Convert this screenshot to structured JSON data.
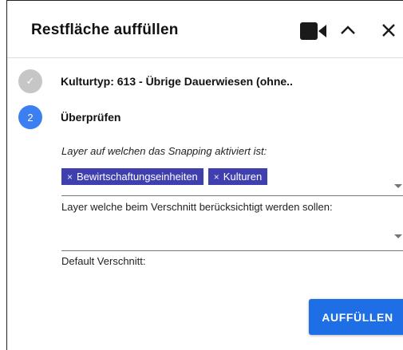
{
  "dialog": {
    "title": "Restfläche auffüllen",
    "header_icons": [
      "video-camera-icon",
      "chevron-up-icon",
      "close-icon"
    ]
  },
  "steps": [
    {
      "number": "✓",
      "label": "Kulturtyp: 613 - Übrige Dauerwiesen (ohne..",
      "state": "done"
    },
    {
      "number": "2",
      "label": "Überprüfen",
      "state": "active"
    }
  ],
  "fields": {
    "snapping_label": "Layer auf welchen das Snapping aktiviert ist:",
    "snapping_chips": [
      {
        "remove": "×",
        "label": "Bewirtschaftungseinheiten"
      },
      {
        "remove": "×",
        "label": "Kulturen"
      }
    ],
    "cut_layers_label": "Layer welche beim Verschnitt berücksichtigt werden sollen:",
    "default_cut_label": "Default Verschnitt:"
  },
  "actions": {
    "fill_label": "AUFFÜLLEN"
  },
  "colors": {
    "accent_blue": "#1e6fe6",
    "step_active": "#3b7ff1",
    "step_done": "#c6c6c6",
    "chip_bg": "#3f3fb0"
  }
}
